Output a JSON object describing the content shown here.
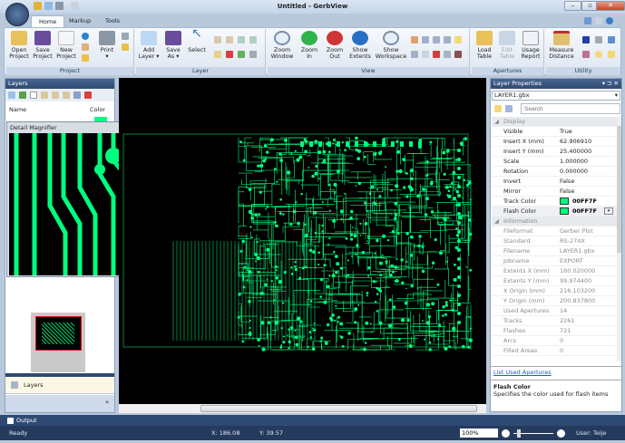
{
  "window": {
    "title": "Untitled - GerbView"
  },
  "tabs": [
    {
      "label": "Home",
      "active": true
    },
    {
      "label": "Markup"
    },
    {
      "label": "Tools"
    }
  ],
  "ribbon": {
    "groups": [
      {
        "label": "Project",
        "buttons": [
          "Open Project",
          "Save Project",
          "New Project",
          "Print"
        ]
      },
      {
        "label": "Layer",
        "buttons": [
          "Add Layer",
          "Save As",
          "Select"
        ]
      },
      {
        "label": "View",
        "buttons": [
          "Zoom Window",
          "Zoom In",
          "Zoom Out",
          "Show Extents",
          "Show Workspace"
        ]
      },
      {
        "label": "Apertures",
        "buttons": [
          "Load Table",
          "Edit Table",
          "Usage Report"
        ]
      },
      {
        "label": "Utility",
        "buttons": [
          "Measure Distance"
        ]
      }
    ]
  },
  "layers_panel": {
    "title": "Layers",
    "col_name": "Name",
    "col_color": "Color",
    "nav_label": "Layers"
  },
  "magnifier": {
    "title": "Detail Magnifier"
  },
  "properties": {
    "title": "Layer Properties",
    "selected_layer": "LAYER1.gbx",
    "search_placeholder": "Search",
    "display_label": "Display",
    "display": [
      {
        "k": "Visible",
        "v": "True"
      },
      {
        "k": "Insert X (mm)",
        "v": "62.906910"
      },
      {
        "k": "Insert Y (mm)",
        "v": "25.400000"
      },
      {
        "k": "Scale",
        "v": "1.000000"
      },
      {
        "k": "Rotation",
        "v": "0.000000"
      },
      {
        "k": "Invert",
        "v": "False"
      },
      {
        "k": "Mirror",
        "v": "False"
      },
      {
        "k": "Track Color",
        "v": "00FF7F"
      },
      {
        "k": "Flash Color",
        "v": "00FF7F"
      }
    ],
    "info_label": "Information",
    "info": [
      {
        "k": "Fileformat",
        "v": "Gerber Plot"
      },
      {
        "k": "Standard",
        "v": "RS-274X"
      },
      {
        "k": "Filename",
        "v": "LAYER1.gbx"
      },
      {
        "k": "Jobname",
        "v": "EXPORT"
      },
      {
        "k": "Extents X (mm)",
        "v": "160.020000"
      },
      {
        "k": "Extents Y (mm)",
        "v": "99.974400"
      },
      {
        "k": "X Origin (mm)",
        "v": "216.103200"
      },
      {
        "k": "Y Origin (mm)",
        "v": "200.837800"
      },
      {
        "k": "Used Apertures",
        "v": "14"
      },
      {
        "k": "Tracks",
        "v": "2261"
      },
      {
        "k": "Flashes",
        "v": "721"
      },
      {
        "k": "Arcs",
        "v": "0"
      },
      {
        "k": "Filled Areas",
        "v": "0"
      }
    ],
    "link": "List Used Apertures",
    "help_title": "Flash Color",
    "help_text": "Specifies the color used for flash items"
  },
  "output": {
    "label": "Output"
  },
  "status": {
    "text": "Ready",
    "x": "X: 186.08",
    "y": "Y: 39.57",
    "zoom": "100%",
    "user": "User: Teije"
  },
  "colors": {
    "trace": "#00ff7f",
    "canvas": "#000000",
    "accent": "#2e4a73"
  }
}
